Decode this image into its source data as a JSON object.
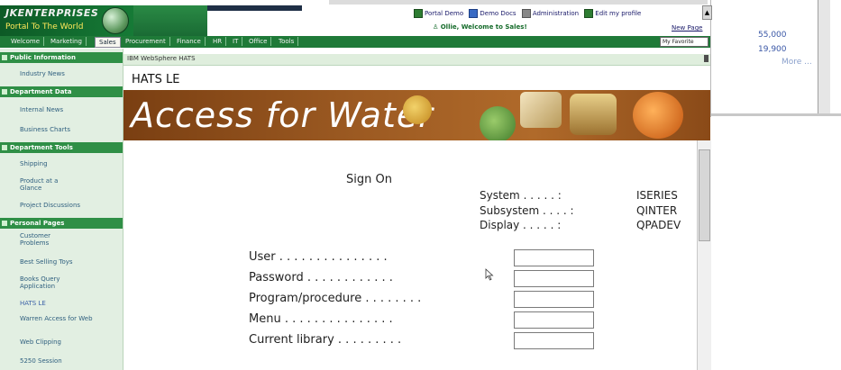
{
  "background_window": {
    "values": [
      "55,000",
      "19,900"
    ],
    "more_link": "More ..."
  },
  "header": {
    "logo_line1": "JKENTERPRISES",
    "logo_line2": "Portal To The World",
    "nav_links": [
      "Portal Demo",
      "Demo Docs",
      "Administration",
      "Edit my profile"
    ],
    "welcome": "Ollie, Welcome to Sales!",
    "new_page": "New Page"
  },
  "tabs": [
    "Welcome",
    "Marketing",
    "Sales",
    "Procurement",
    "Finance",
    "HR",
    "IT",
    "Office",
    "Tools"
  ],
  "active_tab": "Sales",
  "favorites": "My Favorite",
  "sidebar": {
    "sections": [
      {
        "title": "Public Information",
        "items": [
          "Industry News"
        ]
      },
      {
        "title": "Department Data",
        "items": [
          "Internal News",
          "Business Charts"
        ]
      },
      {
        "title": "Department Tools",
        "items": [
          "Shipping",
          "Product at a Glance",
          "Project Discussions"
        ]
      },
      {
        "title": "Personal Pages",
        "items": [
          "Customer Problems",
          "Best Selling Toys",
          "Books Query Application",
          "HATS LE",
          "Warren Access for Web",
          "Web Clipping",
          "5250 Session"
        ]
      }
    ],
    "selected": "HATS LE"
  },
  "portlet": {
    "title": "IBM WebSphere HATS",
    "hats_label": "HATS LE",
    "banner_title": "Access for Water"
  },
  "signon": {
    "title": "Sign On",
    "system_label": "System . . . . . :",
    "system_value": "ISERIES",
    "subsystem_label": "Subsystem . . . . :",
    "subsystem_value": "QINTER",
    "display_label": "Display . . . . . :",
    "display_value": "QPADEV",
    "fields": [
      {
        "label": "User . . . . . . . . . . . . . . .",
        "value": ""
      },
      {
        "label": "Password . . . . . . . . . . . .",
        "value": ""
      },
      {
        "label": "Program/procedure . . . . . . . .",
        "value": ""
      },
      {
        "label": "Menu . . . . . . . . . . . . . . .",
        "value": ""
      },
      {
        "label": "Current library . . . . . . . . .",
        "value": ""
      }
    ]
  },
  "colors": {
    "portal_green": "#1f7a38",
    "sidebar_bg": "#e2efe2",
    "banner_brown": "#9c5a22"
  }
}
